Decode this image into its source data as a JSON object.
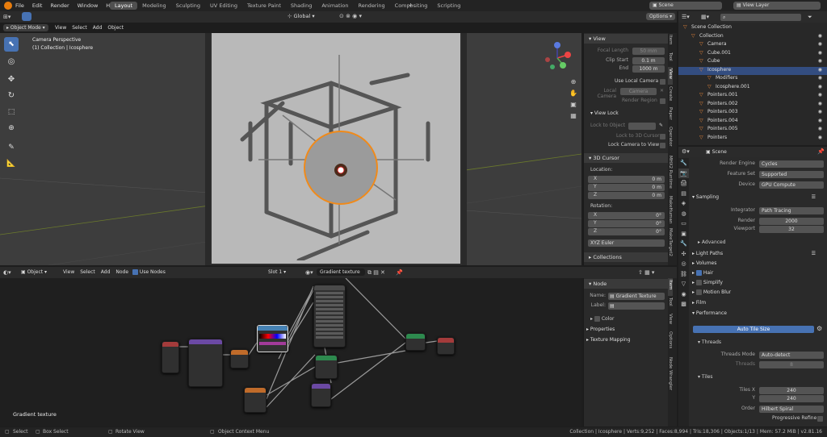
{
  "topbar": {
    "menus": [
      "File",
      "Edit",
      "Render",
      "Window",
      "Help"
    ],
    "workspaces": [
      "Layout",
      "Modeling",
      "Sculpting",
      "UV Editing",
      "Texture Paint",
      "Shading",
      "Animation",
      "Rendering",
      "Compositing",
      "Scripting"
    ],
    "active_workspace": "Layout",
    "scene": "Scene",
    "view_layer": "View Layer"
  },
  "viewport": {
    "mode": "Object Mode",
    "menus": [
      "View",
      "Select",
      "Add",
      "Object"
    ],
    "orientation": "Global",
    "options": "Options",
    "info_line1": "Camera Perspective",
    "info_line2": "(1) Collection | Icosphere"
  },
  "npanel": {
    "view_header": "View",
    "focal_length_label": "Focal Length",
    "focal_length": "50 mm",
    "clip_start_label": "Clip Start",
    "clip_start": "0.1 m",
    "end_label": "End",
    "clip_end": "1000 m",
    "use_local_camera": "Use Local Camera",
    "local_camera_label": "Local Camera",
    "local_camera": "Camera",
    "render_region": "Render Region",
    "view_lock": "View Lock",
    "lock_to_object": "Lock to Object",
    "lock_to_3d_cursor": "Lock to 3D Cursor",
    "lock_camera_to_view": "Lock Camera to View",
    "cursor_header": "3D Cursor",
    "location": "Location:",
    "rotation": "Rotation:",
    "x": "X",
    "y": "Y",
    "z": "Z",
    "loc_x": "0 m",
    "loc_y": "0 m",
    "loc_z": "0 m",
    "rot_x": "0°",
    "rot_y": "0°",
    "rot_z": "0°",
    "rot_mode": "XYZ Euler",
    "collections": "Collections",
    "tabs": [
      "Item",
      "Tool",
      "View",
      "Create",
      "Paper",
      "Operator",
      "MHX2 Runtime",
      "MakeHuman",
      "MakeTarget2"
    ]
  },
  "node_editor": {
    "menus": [
      "View",
      "Select",
      "Add",
      "Node"
    ],
    "object": "Object",
    "use_nodes": "Use Nodes",
    "slot": "Slot 1",
    "material": "Gradient texture",
    "label": "Gradient texture"
  },
  "node_panel": {
    "header": "Node",
    "name_label": "Name:",
    "name": "Gradient Texture",
    "label_label": "Label:",
    "color": "Color",
    "properties": "Properties",
    "texture_mapping": "Texture Mapping",
    "tabs": [
      "Item",
      "Tool",
      "View",
      "Options",
      "Node Wrangler"
    ]
  },
  "outliner": {
    "items": [
      {
        "name": "Scene Collection",
        "indent": 0
      },
      {
        "name": "Collection",
        "indent": 1
      },
      {
        "name": "Camera",
        "indent": 2
      },
      {
        "name": "Cube.001",
        "indent": 2
      },
      {
        "name": "Cube",
        "indent": 2
      },
      {
        "name": "Icosphere",
        "indent": 2,
        "selected": true
      },
      {
        "name": "Modifiers",
        "indent": 3
      },
      {
        "name": "Icosphere.001",
        "indent": 3
      },
      {
        "name": "Pointers.001",
        "indent": 2
      },
      {
        "name": "Pointers.002",
        "indent": 2
      },
      {
        "name": "Pointers.003",
        "indent": 2
      },
      {
        "name": "Pointers.004",
        "indent": 2
      },
      {
        "name": "Pointers.005",
        "indent": 2
      },
      {
        "name": "Pointers",
        "indent": 2
      }
    ]
  },
  "properties": {
    "scene": "Scene",
    "render_engine_label": "Render Engine",
    "render_engine": "Cycles",
    "feature_set_label": "Feature Set",
    "feature_set": "Supported",
    "device_label": "Device",
    "device": "GPU Compute",
    "sampling": "Sampling",
    "integrator_label": "Integrator",
    "integrator": "Path Tracing",
    "render_label": "Render",
    "render": "2000",
    "viewport_label": "Viewport",
    "viewport": "32",
    "advanced": "Advanced",
    "light_paths": "Light Paths",
    "volumes": "Volumes",
    "hair": "Hair",
    "simplify": "Simplify",
    "motion_blur": "Motion Blur",
    "film": "Film",
    "performance": "Performance",
    "auto_tile": "Auto Tile Size",
    "threads": "Threads",
    "threads_mode_label": "Threads Mode",
    "threads_mode": "Auto-detect",
    "threads_label": "Threads",
    "threads_val": "8",
    "tiles": "Tiles",
    "tiles_x_label": "Tiles X",
    "tiles_x": "240",
    "tiles_y_label": "Y",
    "tiles_y": "240",
    "order_label": "Order",
    "order": "Hilbert Spiral",
    "progressive": "Progressive Refine"
  },
  "status": {
    "select": "Select",
    "box_select": "Box Select",
    "rotate_view": "Rotate View",
    "context_menu": "Object Context Menu",
    "stats": "Collection | Icosphere | Verts:9,252 | Faces:8,994 | Tris:18,306 | Objects:1/13 | Mem: 57.2 MiB | v2.81.16"
  }
}
